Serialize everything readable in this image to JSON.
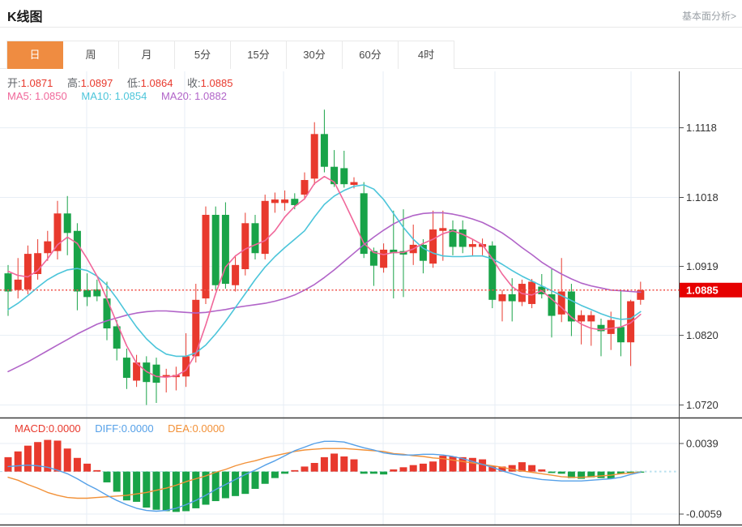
{
  "header": {
    "title": "K线图",
    "link": "基本面分析>"
  },
  "tabs": {
    "items": [
      {
        "label": "日",
        "active": true
      },
      {
        "label": "周"
      },
      {
        "label": "月"
      },
      {
        "label": "5分"
      },
      {
        "label": "15分"
      },
      {
        "label": "30分"
      },
      {
        "label": "60分"
      },
      {
        "label": "4时"
      }
    ]
  },
  "legend": {
    "ohlc": [
      {
        "label": "开:",
        "value": "1.0871"
      },
      {
        "label": "高:",
        "value": "1.0897"
      },
      {
        "label": "低:",
        "value": "1.0864"
      },
      {
        "label": "收:",
        "value": "1.0885"
      }
    ],
    "ma": [
      {
        "label": "MA5:",
        "value": "1.0850"
      },
      {
        "label": "MA10:",
        "value": "1.0854"
      },
      {
        "label": "MA20:",
        "value": "1.0882"
      }
    ],
    "macd": [
      {
        "label": "MACD:",
        "value": "0.0000"
      },
      {
        "label": "DIFF:",
        "value": "0.0000"
      },
      {
        "label": "DEA:",
        "value": "0.0000"
      }
    ]
  },
  "colors": {
    "accent": "#ef8c41",
    "up": "#e8392d",
    "down": "#18a348",
    "ma5": "#f0679a",
    "ma10": "#4cc5da",
    "ma20": "#b164c8",
    "diff": "#55a0e8",
    "dea": "#f29138",
    "grid": "#e7eef5",
    "axis_line": "#4a4a4a",
    "axis_text": "#333333",
    "badge_bg": "#e60000",
    "badge_text": "#ffffff",
    "last_price_line": "#f0524a",
    "zero_dash": "#b9e0ef"
  },
  "chart_data": {
    "type": "candlestick+macd",
    "title": "K线图",
    "price_axis": {
      "ticks": [
        {
          "label": "1.1118",
          "price": 1.1118
        },
        {
          "label": "1.1018",
          "price": 1.1018
        },
        {
          "label": "1.0919",
          "price": 1.0919
        },
        {
          "label": "1.0820",
          "price": 1.082
        },
        {
          "label": "1.0720",
          "price": 1.072
        }
      ],
      "last_price": {
        "label": "1.0885",
        "price": 1.0885
      },
      "range": {
        "top": 1.1199,
        "bottom": 1.0702
      }
    },
    "macd_axis": {
      "ticks": [
        {
          "label": "0.0039",
          "value": 0.0039
        },
        {
          "label": "-0.0059",
          "value": -0.0059
        }
      ],
      "range": {
        "top": 0.00728,
        "bottom": -0.00736
      }
    },
    "grid_x": [
      107,
      228,
      350,
      473,
      611,
      779
    ],
    "candles": [
      [
        1.0909,
        1.0921,
        1.0848,
        1.0883
      ],
      [
        1.0885,
        1.0931,
        1.0873,
        1.09
      ],
      [
        1.0886,
        1.0949,
        1.0879,
        1.0937
      ],
      [
        1.0908,
        1.0958,
        1.09,
        1.0938
      ],
      [
        1.0938,
        1.097,
        1.0927,
        1.0955
      ],
      [
        1.0941,
        1.1013,
        1.0929,
        1.0995
      ],
      [
        1.0995,
        1.102,
        1.0935,
        1.0967
      ],
      [
        1.097,
        1.0981,
        1.0856,
        1.0883
      ],
      [
        1.0885,
        1.0909,
        1.0862,
        1.0875
      ],
      [
        1.0886,
        1.09,
        1.0869,
        1.0876
      ],
      [
        1.0873,
        1.0897,
        1.0813,
        1.083
      ],
      [
        1.0833,
        1.0842,
        1.0784,
        1.0801
      ],
      [
        1.0788,
        1.0801,
        1.0743,
        1.0759
      ],
      [
        1.0755,
        1.0792,
        1.0746,
        1.0781
      ],
      [
        1.0781,
        1.079,
        1.072,
        1.0753
      ],
      [
        1.0778,
        1.0788,
        1.0723,
        1.0752
      ],
      [
        1.076,
        1.0772,
        1.0738,
        1.0763
      ],
      [
        1.076,
        1.0775,
        1.0741,
        1.0763
      ],
      [
        1.0761,
        1.0823,
        1.0746,
        1.079
      ],
      [
        1.079,
        1.0894,
        1.0781,
        1.0871
      ],
      [
        1.0873,
        1.1005,
        1.0865,
        1.0993
      ],
      [
        1.0993,
        1.1005,
        1.0885,
        1.0892
      ],
      [
        1.0993,
        1.1011,
        1.0887,
        1.0894
      ],
      [
        1.0892,
        1.0935,
        1.0883,
        1.0921
      ],
      [
        1.0915,
        1.0996,
        1.0906,
        1.0981
      ],
      [
        1.0981,
        1.0993,
        1.0929,
        1.0938
      ],
      [
        1.0937,
        1.1022,
        1.0929,
        1.1013
      ],
      [
        1.101,
        1.1025,
        1.0996,
        1.1015
      ],
      [
        1.101,
        1.1028,
        1.0999,
        1.1015
      ],
      [
        1.1016,
        1.1024,
        1.1001,
        1.1007
      ],
      [
        1.1022,
        1.1054,
        1.1015,
        1.1043
      ],
      [
        1.1045,
        1.1126,
        1.1036,
        1.1109
      ],
      [
        1.1109,
        1.1144,
        1.1054,
        1.1062
      ],
      [
        1.1062,
        1.1086,
        1.1033,
        1.1037
      ],
      [
        1.106,
        1.1085,
        1.1032,
        1.1037
      ],
      [
        1.1036,
        1.1047,
        1.1031,
        1.104
      ],
      [
        1.1024,
        1.104,
        1.0931,
        1.0937
      ],
      [
        1.0941,
        1.0946,
        1.0891,
        1.092
      ],
      [
        1.0917,
        1.0952,
        1.091,
        1.0943
      ],
      [
        1.0943,
        1.0999,
        1.0873,
        1.0938
      ],
      [
        1.0941,
        1.1001,
        1.0875,
        1.0936
      ],
      [
        1.0938,
        1.0979,
        1.0921,
        1.095
      ],
      [
        1.095,
        1.0958,
        1.0909,
        1.0927
      ],
      [
        1.0923,
        1.0999,
        1.0917,
        1.0972
      ],
      [
        1.097,
        1.0999,
        1.0927,
        1.0974
      ],
      [
        1.0972,
        1.0985,
        1.0935,
        1.0947
      ],
      [
        1.0972,
        1.0985,
        1.0938,
        1.0947
      ],
      [
        1.0947,
        1.0958,
        1.0933,
        1.0951
      ],
      [
        1.0947,
        1.0959,
        1.0935,
        1.0951
      ],
      [
        1.0949,
        1.0955,
        1.0859,
        1.0871
      ],
      [
        1.0869,
        1.0885,
        1.084,
        1.0879
      ],
      [
        1.0879,
        1.0902,
        1.084,
        1.0869
      ],
      [
        1.0868,
        1.09,
        1.0862,
        1.0894
      ],
      [
        1.0865,
        1.0901,
        1.0859,
        1.0897
      ],
      [
        1.089,
        1.0908,
        1.0873,
        1.0879
      ],
      [
        1.0879,
        1.0915,
        1.0817,
        1.0848
      ],
      [
        1.085,
        1.0931,
        1.0839,
        1.0883
      ],
      [
        1.0883,
        1.0894,
        1.0819,
        1.084
      ],
      [
        1.084,
        1.0856,
        1.0807,
        1.0849
      ],
      [
        1.084,
        1.0855,
        1.0805,
        1.0849
      ],
      [
        1.0835,
        1.0844,
        1.079,
        1.0826
      ],
      [
        1.0822,
        1.0854,
        1.0799,
        1.0842
      ],
      [
        1.0832,
        1.0885,
        1.079,
        1.081
      ],
      [
        1.081,
        1.0871,
        1.0776,
        1.0869
      ],
      [
        1.0871,
        1.0897,
        1.0864,
        1.0885
      ]
    ],
    "ma5": [
      1.0912,
      1.0906,
      1.0904,
      1.0913,
      1.093,
      1.095,
      1.0961,
      1.0952,
      1.093,
      1.0905,
      1.0872,
      1.0838,
      1.0805,
      1.078,
      1.0768,
      1.0761,
      1.076,
      1.0762,
      1.077,
      1.0794,
      1.0835,
      1.088,
      1.0918,
      1.0934,
      1.0944,
      1.095,
      1.0956,
      1.097,
      1.099,
      1.1005,
      1.1016,
      1.1038,
      1.1048,
      1.104,
      1.1012,
      1.0982,
      1.0952,
      1.0939,
      1.0936,
      1.0939,
      1.0939,
      1.0944,
      1.0952,
      1.0958,
      1.0966,
      1.097,
      1.0965,
      1.0958,
      1.095,
      1.093,
      1.0908,
      1.089,
      1.088,
      1.0878,
      1.0884,
      1.0872,
      1.086,
      1.0846,
      1.0836,
      1.083,
      1.0828,
      1.083,
      1.0832,
      1.0838,
      1.085
    ],
    "ma10": [
      1.0857,
      1.0866,
      1.0877,
      1.0889,
      1.09,
      1.0908,
      1.0914,
      1.0916,
      1.0913,
      1.0905,
      1.0892,
      1.0873,
      1.0852,
      1.0832,
      1.0815,
      1.0802,
      1.0793,
      1.079,
      1.079,
      1.0795,
      1.0806,
      1.0822,
      1.084,
      1.086,
      1.088,
      1.09,
      1.0918,
      1.0933,
      1.0946,
      1.0958,
      1.097,
      1.099,
      1.1008,
      1.102,
      1.1028,
      1.1034,
      1.1036,
      1.103,
      1.1015,
      1.0995,
      1.0975,
      1.0958,
      1.0945,
      1.0938,
      1.0934,
      1.0933,
      1.0933,
      1.0934,
      1.0934,
      1.093,
      1.0922,
      1.0913,
      1.0905,
      1.0898,
      1.0891,
      1.0884,
      1.0877,
      1.087,
      1.0863,
      1.0857,
      1.0851,
      1.0846,
      1.0843,
      1.0844,
      1.0854
    ],
    "ma20": [
      1.0768,
      1.0775,
      1.0782,
      1.079,
      1.0798,
      1.0806,
      1.0814,
      1.0822,
      1.0829,
      1.0836,
      1.0841,
      1.0845,
      1.0849,
      1.0852,
      1.0854,
      1.0855,
      1.0855,
      1.0854,
      1.0853,
      1.0852,
      1.0853,
      1.0855,
      1.0857,
      1.086,
      1.0862,
      1.0864,
      1.0866,
      1.0869,
      1.0873,
      1.0878,
      1.0885,
      1.0893,
      1.0903,
      1.0914,
      1.0926,
      1.0938,
      1.095,
      1.0961,
      1.0971,
      1.098,
      1.0987,
      1.0992,
      1.0995,
      1.0996,
      1.0996,
      1.0994,
      1.0991,
      1.0987,
      1.0982,
      1.0975,
      1.0967,
      1.0957,
      1.0946,
      1.0936,
      1.0925,
      1.0916,
      1.0908,
      1.0901,
      1.0895,
      1.0891,
      1.0888,
      1.0885,
      1.0884,
      1.0883,
      1.0882
    ],
    "macd": {
      "hist": [
        0.002,
        0.0028,
        0.0036,
        0.0041,
        0.0044,
        0.0043,
        0.0032,
        0.0019,
        0.0011,
        0.0002,
        -0.0015,
        -0.0028,
        -0.004,
        -0.0042,
        -0.005,
        -0.0053,
        -0.0055,
        -0.0056,
        -0.0055,
        -0.0051,
        -0.0046,
        -0.0041,
        -0.0037,
        -0.0034,
        -0.0031,
        -0.0024,
        -0.0017,
        -0.0009,
        -0.0003,
        0.0002,
        0.0007,
        0.0012,
        0.002,
        0.0025,
        0.0021,
        0.0017,
        -0.0003,
        -0.0003,
        -0.0004,
        0.0003,
        0.0006,
        0.0009,
        0.0011,
        0.0014,
        0.0022,
        0.0021,
        0.002,
        0.0019,
        0.0017,
        0.0008,
        0.0007,
        0.0009,
        0.0013,
        0.0009,
        0.0003,
        -0.0002,
        -0.0003,
        -0.0009,
        -0.001,
        -0.0008,
        -0.0009,
        -0.001,
        -0.0003,
        -0.0002,
        -0.0001
      ],
      "diff": [
        0.0007,
        0.0008,
        0.0009,
        0.0008,
        0.0006,
        0.0002,
        -0.0003,
        -0.001,
        -0.0018,
        -0.0025,
        -0.0033,
        -0.004,
        -0.0046,
        -0.0051,
        -0.0054,
        -0.0055,
        -0.0054,
        -0.0051,
        -0.0046,
        -0.004,
        -0.0033,
        -0.0025,
        -0.0018,
        -0.0011,
        -0.0004,
        0.0002,
        0.0009,
        0.0015,
        0.0022,
        0.0029,
        0.0034,
        0.0039,
        0.0042,
        0.0042,
        0.0041,
        0.0037,
        0.0033,
        0.003,
        0.0026,
        0.0024,
        0.0023,
        0.0023,
        0.0024,
        0.0024,
        0.0023,
        0.0021,
        0.0018,
        0.0014,
        0.001,
        0.0006,
        0.0001,
        -0.0003,
        -0.0007,
        -0.0009,
        -0.0011,
        -0.0012,
        -0.0013,
        -0.0013,
        -0.0013,
        -0.0012,
        -0.0011,
        -0.001,
        -0.0008,
        -0.0004,
        -0.0001
      ],
      "dea": [
        -0.0008,
        -0.0012,
        -0.0018,
        -0.0023,
        -0.0029,
        -0.0033,
        -0.0036,
        -0.0037,
        -0.0037,
        -0.0036,
        -0.0035,
        -0.0034,
        -0.0033,
        -0.0031,
        -0.0029,
        -0.0026,
        -0.0023,
        -0.0019,
        -0.0014,
        -0.001,
        -0.0006,
        -0.0001,
        0.0003,
        0.0008,
        0.0012,
        0.0015,
        0.0019,
        0.0022,
        0.0025,
        0.0028,
        0.003,
        0.0031,
        0.0032,
        0.0032,
        0.0032,
        0.0031,
        0.003,
        0.0029,
        0.0028,
        0.0025,
        0.0024,
        0.0022,
        0.0021,
        0.0019,
        0.0018,
        0.0016,
        0.0014,
        0.0012,
        0.001,
        0.0008,
        0.0006,
        0.0003,
        0.0001,
        -0.0001,
        -0.0003,
        -0.0005,
        -0.0007,
        -0.0008,
        -0.0008,
        -0.0007,
        -0.0006,
        -0.0005,
        -0.0003,
        -0.0002,
        -0.0001
      ]
    }
  }
}
